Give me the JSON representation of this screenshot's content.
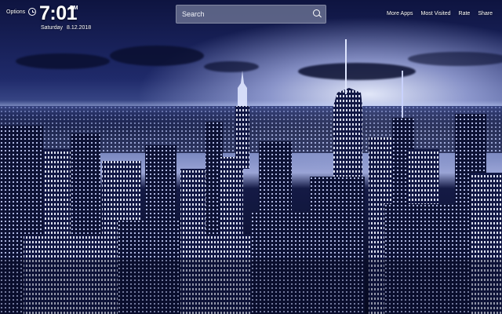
{
  "top_left": {
    "options_label": "Options",
    "time": "7:01",
    "ampm": "PM",
    "day": "Saturday",
    "date": "8.12.2018"
  },
  "search": {
    "placeholder": "Search"
  },
  "nav": {
    "items": [
      {
        "label": "More Apps"
      },
      {
        "label": "Most Visited"
      },
      {
        "label": "Rate"
      },
      {
        "label": "Share"
      }
    ]
  },
  "colors": {
    "sky_glow": "#dfe5ff",
    "city_dark": "#070a22",
    "window_light": "#e8ecff",
    "search_bg": "#6e7696"
  },
  "icons": {
    "clock": "clock-icon",
    "search": "search-icon"
  }
}
